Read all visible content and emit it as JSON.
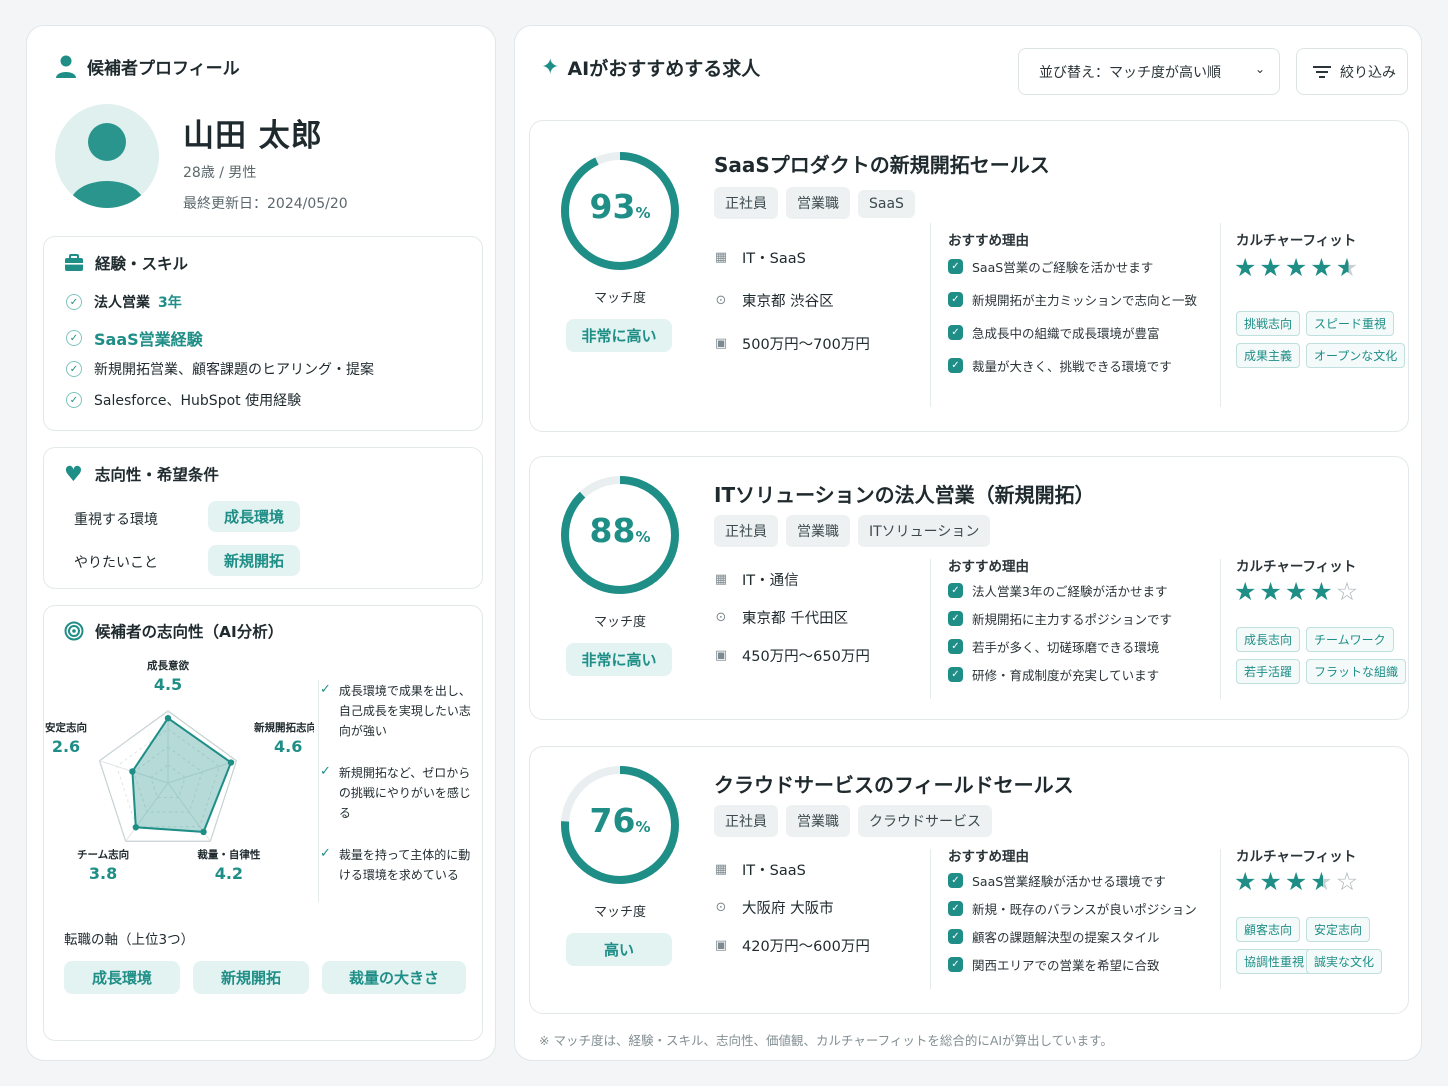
{
  "profile": {
    "section_title": "候補者プロフィール",
    "name": "山田 太郎",
    "age_gender": "28歳 / 男性",
    "updated": "最終更新日：2024/05/20"
  },
  "skills": {
    "title": "経験・スキル",
    "items": [
      {
        "label": "法人営業",
        "value": "3年"
      },
      {
        "label": "SaaS営業経験"
      },
      {
        "label": "新規開拓営業、顧客課題のヒアリング・提案"
      },
      {
        "label": "Salesforce、HubSpot 使用経験"
      }
    ]
  },
  "preferences": {
    "title": "志向性・希望条件",
    "rows": [
      {
        "label": "重視する環境",
        "value": "成長環境"
      },
      {
        "label": "やりたいこと",
        "value": "新規開拓"
      }
    ]
  },
  "analysis": {
    "title": "候補者の志向性（AI分析）",
    "axes": [
      {
        "label": "成長意欲",
        "value": 4.5
      },
      {
        "label": "新規開拓志向",
        "value": 4.6
      },
      {
        "label": "裁量・自律性",
        "value": 4.2
      },
      {
        "label": "チーム志向",
        "value": 3.8
      },
      {
        "label": "安定志向",
        "value": 2.6
      }
    ],
    "insights": [
      "成長環境で成果を出し、自己成長を実現したい志向が強い",
      "新規開拓など、ゼロからの挑戦にやりがいを感じる",
      "裁量を持って主体的に動ける環境を求めている"
    ],
    "axis_title": "転職の軸（上位3つ）",
    "top_axes": [
      "成長環境",
      "新規開拓",
      "裁量の大きさ"
    ]
  },
  "recommend": {
    "title": "AIがおすすめする求人",
    "sort_label": "並び替え：マッチ度が高い順",
    "filter_label": "絞り込み",
    "footnote": "※ マッチ度は、経験・スキル、志向性、価値観、カルチャーフィットを総合的にAIが算出しています。",
    "match_label": "マッチ度",
    "reason_label": "おすすめ理由",
    "culture_label": "カルチャーフィット",
    "jobs": [
      {
        "title": "SaaSプロダクトの新規開拓セールス",
        "match": 93,
        "percent": "%",
        "level": "非常に高い",
        "tags": [
          "正社員",
          "営業職",
          "SaaS"
        ],
        "industry": "IT・SaaS",
        "location": "東京都 渋谷区",
        "salary": "500万円〜700万円",
        "reasons": [
          "SaaS営業のご経験を活かせます",
          "新規開拓が主力ミッションで志向と一致",
          "急成長中の組織で成長環境が豊富",
          "裁量が大きく、挑戦できる環境です"
        ],
        "rating": 4.5,
        "culture_tags": [
          "挑戦志向",
          "スピード重視",
          "成果主義",
          "オープンな文化"
        ]
      },
      {
        "title": "ITソリューションの法人営業（新規開拓）",
        "match": 88,
        "percent": "%",
        "level": "非常に高い",
        "tags": [
          "正社員",
          "営業職",
          "ITソリューション"
        ],
        "industry": "IT・通信",
        "location": "東京都 千代田区",
        "salary": "450万円〜650万円",
        "reasons": [
          "法人営業3年のご経験が活かせます",
          "新規開拓に主力するポジションです",
          "若手が多く、切磋琢磨できる環境",
          "研修・育成制度が充実しています"
        ],
        "rating": 4,
        "culture_tags": [
          "成長志向",
          "チームワーク",
          "若手活躍",
          "フラットな組織"
        ]
      },
      {
        "title": "クラウドサービスのフィールドセールス",
        "match": 76,
        "percent": "%",
        "level": "高い",
        "tags": [
          "正社員",
          "営業職",
          "クラウドサービス"
        ],
        "industry": "IT・SaaS",
        "location": "大阪府 大阪市",
        "salary": "420万円〜600万円",
        "reasons": [
          "SaaS営業経験が活かせる環境です",
          "新規・既存のバランスが良いポジション",
          "顧客の課題解決型の提案スタイル",
          "関西エリアでの営業を希望に合致"
        ],
        "rating": 3.5,
        "culture_tags": [
          "顧客志向",
          "安定志向",
          "協調性重視",
          "誠実な文化"
        ]
      }
    ]
  },
  "colors": {
    "accent": "#1e8e87",
    "accent_light": "#e3f3f1"
  }
}
